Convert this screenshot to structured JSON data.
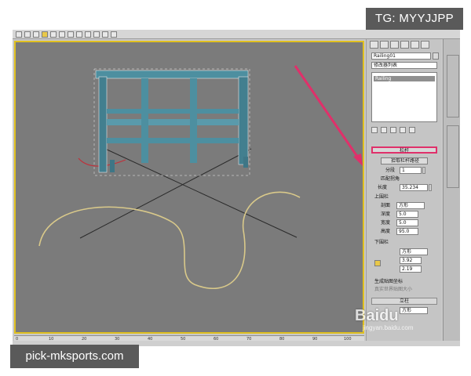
{
  "watermarks": {
    "telegram": "TG: MYYJJPP",
    "site": "pick-mksports.com",
    "baidu": "Baidu",
    "baidu_sub": "jingyan.baidu.com"
  },
  "panel": {
    "object_name": "Railing01",
    "modifier_list": "修改器列表",
    "stack_item": "Railing",
    "rollout_railing": "栏杆",
    "pick_path_button": "拾取栏杆路径",
    "segments_label": "分段",
    "segments_value": "1",
    "match_corners_label": "匹配拐角",
    "length_label": "长度",
    "length_value": "35.234",
    "top_rail_label": "上围栏",
    "profile_label": "剖面",
    "profile_value": "方形",
    "depth_label": "深度",
    "depth_value": "5.0",
    "width_label": "宽度",
    "width_value": "5.0",
    "height_label": "高度",
    "height_value": "95.0",
    "lower_rail_label": "下围栏",
    "lower_profile_value": "方形",
    "lower_depth_value": "3.92",
    "lower_width_value": "2.19",
    "gen_mapping_label": "生成贴图坐标",
    "real_world_label": "真实世界贴图大小",
    "rollout_posts": "立柱",
    "posts_profile_value": "方形"
  },
  "timeline": {
    "ticks": [
      "0",
      "10",
      "20",
      "30",
      "40",
      "50",
      "60",
      "70",
      "80",
      "90",
      "100"
    ]
  },
  "colors": {
    "viewport_bg": "#7b7b7b",
    "railing": "#4d8fa0",
    "annotation_arrow": "#e0306a",
    "spline": "#d9c98a"
  }
}
